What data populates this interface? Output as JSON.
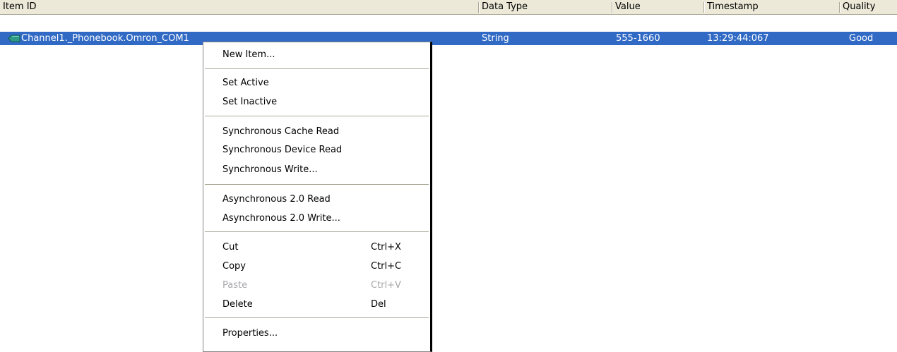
{
  "columns": {
    "item_id": "Item ID",
    "data_type": "Data Type",
    "value": "Value",
    "timestamp": "Timestamp",
    "quality": "Quality"
  },
  "row": {
    "icon": "tag-icon",
    "item_id": "Channel1._Phonebook.Omron_COM1",
    "data_type": "String",
    "value": "555-1660",
    "timestamp": "13:29:44:067",
    "quality": "Good"
  },
  "context_menu": {
    "new_item": "New Item...",
    "set_active": "Set Active",
    "set_inactive": "Set Inactive",
    "sync_cache_read": "Synchronous Cache Read",
    "sync_device_read": "Synchronous Device Read",
    "sync_write": "Synchronous Write...",
    "async_read": "Asynchronous 2.0 Read",
    "async_write": "Asynchronous 2.0 Write...",
    "cut": "Cut",
    "cut_shortcut": "Ctrl+X",
    "copy": "Copy",
    "copy_shortcut": "Ctrl+C",
    "paste": "Paste",
    "paste_shortcut": "Ctrl+V",
    "delete": "Delete",
    "delete_shortcut": "Del",
    "properties": "Properties..."
  },
  "colors": {
    "selection": "#316ac5",
    "header_bg": "#ece9d8",
    "disabled_text": "#a7a6aa"
  }
}
